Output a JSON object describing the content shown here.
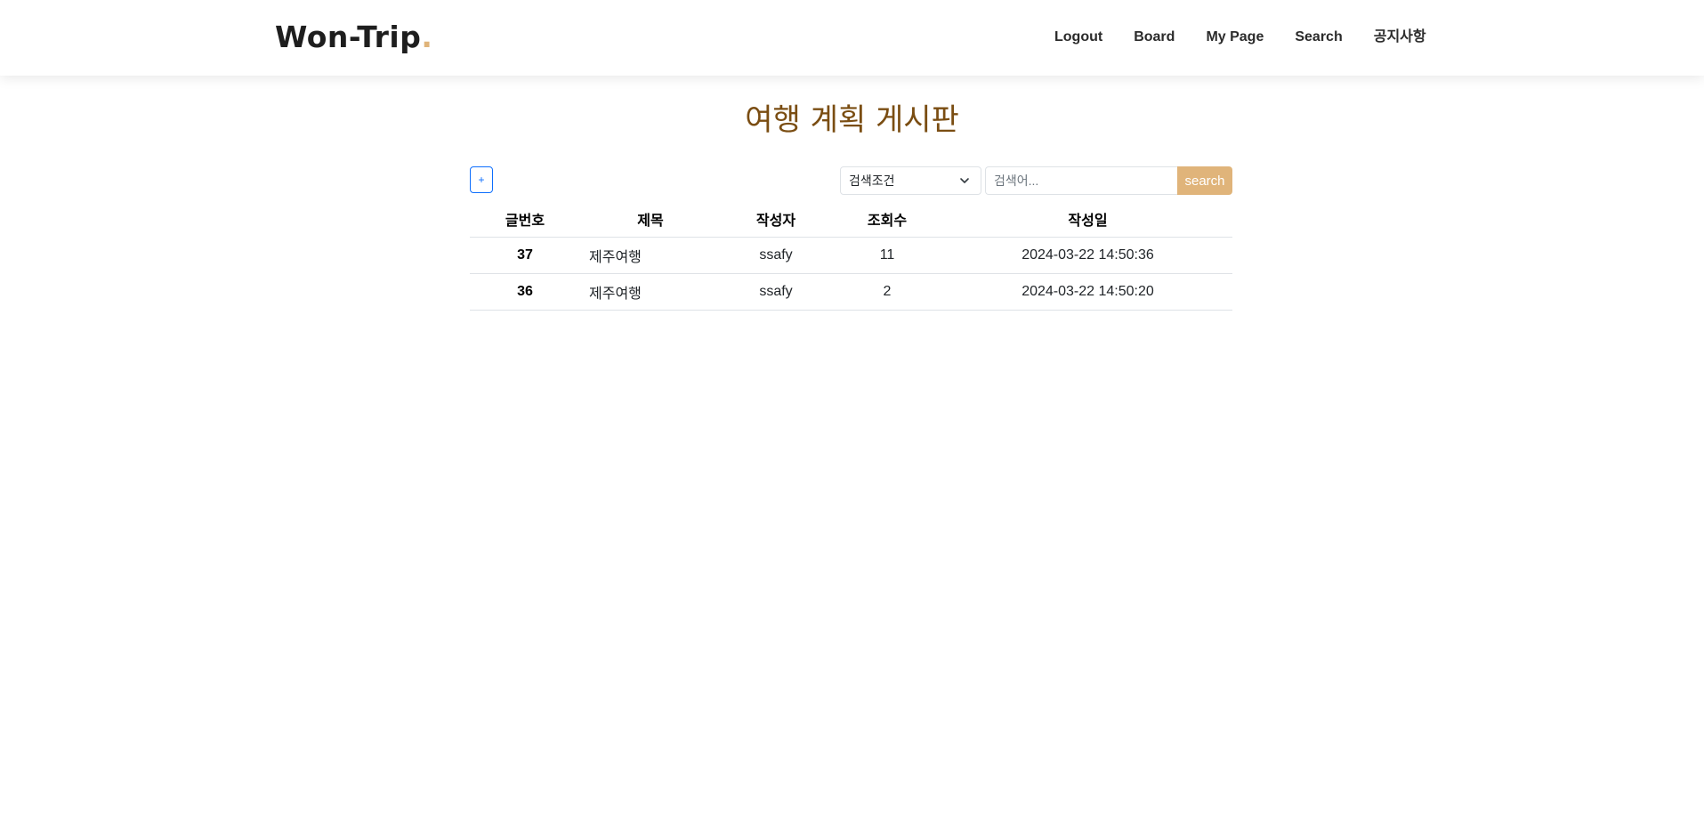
{
  "header": {
    "brand": "Won-Trip",
    "brand_dot": ".",
    "nav": [
      "Logout",
      "Board",
      "My Page",
      "Search",
      "공지사항"
    ]
  },
  "page_title": "여행 계획 게시판",
  "toolbar": {
    "add_label": "+",
    "select_value": "검색조건",
    "search_placeholder": "검색어...",
    "search_button": "search"
  },
  "table": {
    "headers": [
      "글번호",
      "제목",
      "작성자",
      "조회수",
      "작성일"
    ],
    "rows": [
      {
        "no": "37",
        "title": "제주여행",
        "writer": "ssafy",
        "hit": "11",
        "date": "2024-03-22 14:50:36"
      },
      {
        "no": "36",
        "title": "제주여행",
        "writer": "ssafy",
        "hit": "2",
        "date": "2024-03-22 14:50:20"
      }
    ]
  },
  "colors": {
    "accent": "#e0b47a",
    "title": "#7a4d12",
    "primary": "#0d6efd"
  }
}
